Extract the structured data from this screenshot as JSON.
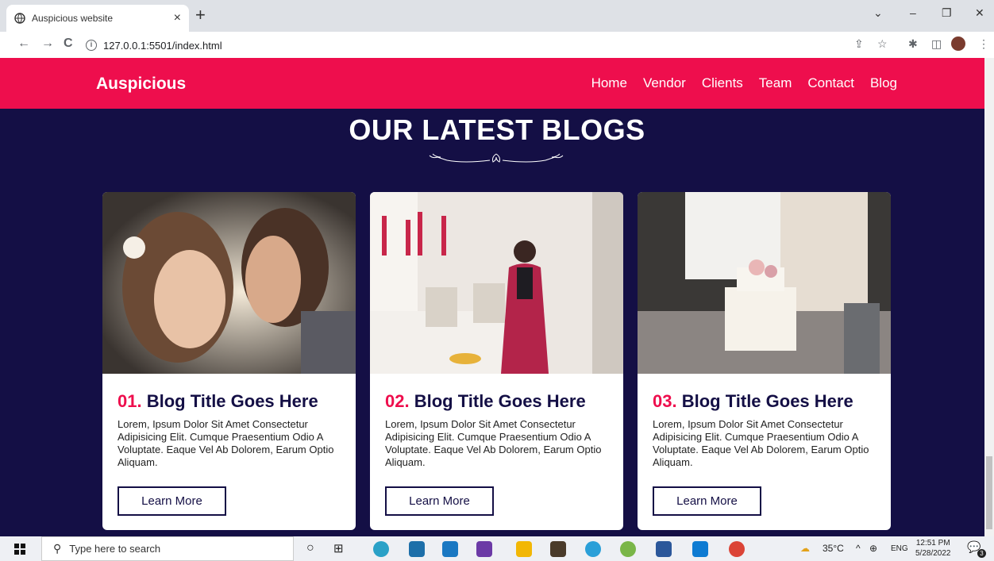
{
  "browser": {
    "tab_title": "Auspicious website",
    "url": "127.0.0.1:5501/index.html"
  },
  "site": {
    "brand": "Auspicious",
    "menu": [
      "Home",
      "Vendor",
      "Clients",
      "Team",
      "Contact",
      "Blog"
    ]
  },
  "blogs": {
    "title": "OUR LATEST BLOGS",
    "cards": [
      {
        "num": "01.",
        "title": "Blog Title Goes Here",
        "text": "Lorem, Ipsum Dolor Sit Amet Consectetur Adipisicing Elit. Cumque Praesentium Odio A Voluptate. Eaque Vel Ab Dolorem, Earum Optio Aliquam.",
        "button": "Learn More"
      },
      {
        "num": "02.",
        "title": "Blog Title Goes Here",
        "text": "Lorem, Ipsum Dolor Sit Amet Consectetur Adipisicing Elit. Cumque Praesentium Odio A Voluptate. Eaque Vel Ab Dolorem, Earum Optio Aliquam.",
        "button": "Learn More"
      },
      {
        "num": "03.",
        "title": "Blog Title Goes Here",
        "text": "Lorem, Ipsum Dolor Sit Amet Consectetur Adipisicing Elit. Cumque Praesentium Odio A Voluptate. Eaque Vel Ab Dolorem, Earum Optio Aliquam.",
        "button": "Learn More"
      }
    ]
  },
  "taskbar": {
    "search_placeholder": "Type here to search",
    "weather": "35°C",
    "lang": "ENG",
    "time": "12:51 PM",
    "date": "5/28/2022",
    "notif_count": "3"
  },
  "colors": {
    "accent": "#ee0e4d",
    "navy": "#140f45"
  }
}
